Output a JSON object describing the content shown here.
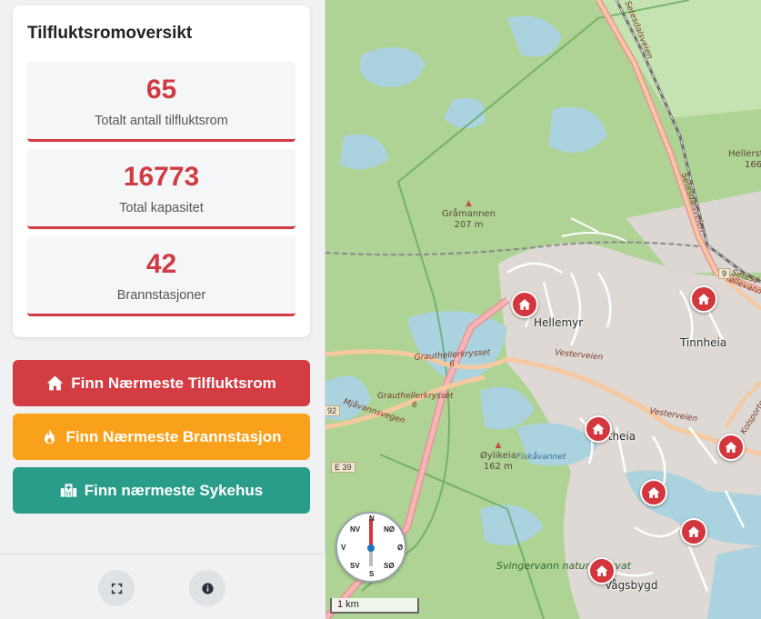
{
  "sidebar": {
    "title": "Tilfluktsromoversikt",
    "stats": [
      {
        "value": "65",
        "label": "Totalt antall tilfluktsrom"
      },
      {
        "value": "16773",
        "label": "Total kapasitet"
      },
      {
        "value": "42",
        "label": "Brannstasjoner"
      }
    ],
    "buttons": {
      "shelter": "Finn Nærmeste Tilfluktsrom",
      "fire": "Finn Nærmeste Brannstasjon",
      "hospital": "Finn nærmeste Sykehus"
    },
    "footer_icons": [
      "fullscreen-icon",
      "info-icon"
    ]
  },
  "colors": {
    "accent_red": "#d43c43",
    "accent_orange": "#f9a11b",
    "accent_teal": "#2a9d8a"
  },
  "map": {
    "places": {
      "hellemyr": "Hellemyr",
      "tinnheia": "Tinnheia",
      "fortheia": "Fortheia",
      "vagsbygd": "Vågsbygd",
      "hellerst": "Hellerst",
      "hellerst_num": "166"
    },
    "hills": {
      "gramannen": "Gråmannen",
      "gramannen_elev": "207 m",
      "oylikeia": "Øylikeia",
      "oylikeia_elev": "162 m"
    },
    "roads": {
      "grauthellerkrysset_1": "Grauthellerkrysset",
      "grauthellerkrysset_1_num": "6",
      "grauthellerkrysset_2": "Grauthellerkrysset",
      "grauthellerkrysset_2_num": "6",
      "mjavannsvegen": "Mjåvannsvegen",
      "vesterveien_1": "Vesterveien",
      "vesterveien_2": "Vesterveien",
      "setesdalsveien_1": "Setesdalsveien",
      "setesdalsveien_2": "Setesdalsveien",
      "mollevannsveien": "Møllevannsveien",
      "setesd": "Setesd",
      "kolsportveien": "Kolsporten"
    },
    "water": {
      "fiskavannet": "Fiskåvannet"
    },
    "park": {
      "svingervann": "Svingervann naturreservat"
    },
    "shields": {
      "e39": "E 39",
      "r92": "92",
      "r9": "9"
    },
    "compass": {
      "n": "N",
      "no": "NØ",
      "o": "Ø",
      "so": "SØ",
      "s": "S",
      "sv": "SV",
      "v": "V",
      "nv": "NV"
    },
    "scale_label": "1 km"
  }
}
